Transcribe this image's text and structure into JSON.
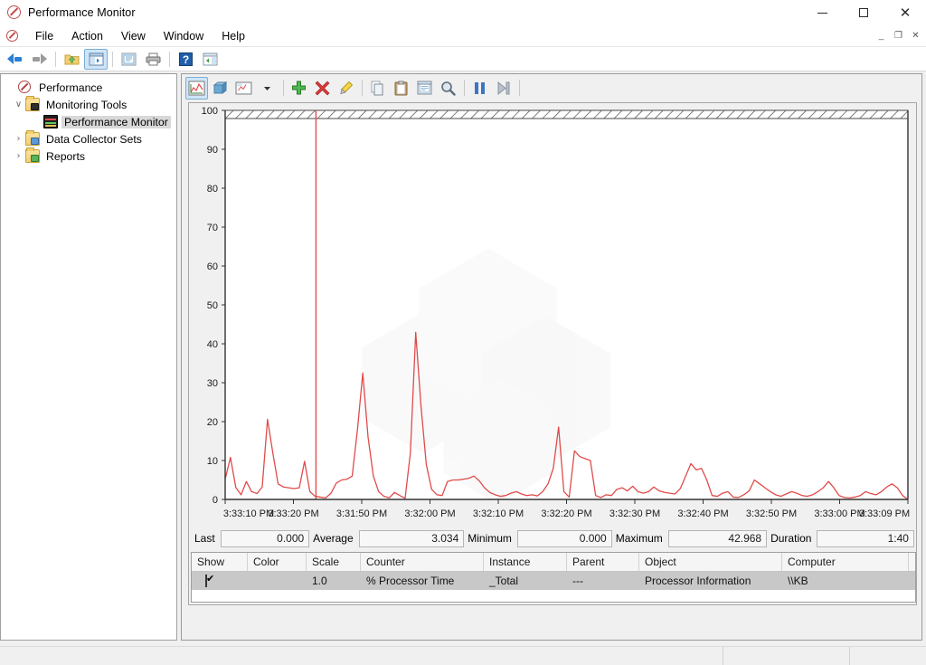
{
  "window": {
    "title": "Performance Monitor",
    "icon": "nosign-icon",
    "controls": {
      "minimize": "—",
      "maximize": "□",
      "close": "✕"
    }
  },
  "menubar": {
    "items": [
      "File",
      "Action",
      "View",
      "Window",
      "Help"
    ],
    "mdi_controls": {
      "minimize": "–",
      "restore": "❐",
      "close": "✕"
    }
  },
  "toolbar": {
    "items": [
      {
        "name": "back-arrow-icon",
        "tooltip": "Back"
      },
      {
        "name": "forward-arrow-icon",
        "tooltip": "Forward"
      },
      {
        "name": "up-folder-icon",
        "tooltip": "Up One Level"
      },
      {
        "name": "show-hide-console-tree-icon",
        "tooltip": "Show/Hide Console Tree",
        "active": true
      },
      {
        "name": "properties-icon",
        "tooltip": "Properties"
      },
      {
        "name": "print-icon",
        "tooltip": "Print"
      },
      {
        "name": "help-icon",
        "tooltip": "Help"
      },
      {
        "name": "new-window-icon",
        "tooltip": "New Window"
      }
    ]
  },
  "sidebar": {
    "tree": [
      {
        "label": "Performance",
        "level": 0,
        "twist": "",
        "icon": "nosign-icon",
        "selected": false
      },
      {
        "label": "Monitoring Tools",
        "level": 1,
        "twist": "∨",
        "icon": "folder-monitor-icon",
        "selected": false
      },
      {
        "label": "Performance Monitor",
        "level": 2,
        "twist": "",
        "icon": "perfmon-icon",
        "selected": true
      },
      {
        "label": "Data Collector Sets",
        "level": 1,
        "twist": "›",
        "icon": "folder-blue-icon",
        "selected": false
      },
      {
        "label": "Reports",
        "level": 1,
        "twist": "›",
        "icon": "folder-green-icon",
        "selected": false
      }
    ]
  },
  "graph_toolbar": {
    "items": [
      {
        "name": "view-graph-icon",
        "tooltip": "View Graph",
        "active": true
      },
      {
        "name": "view-histogram-icon",
        "tooltip": "View Histogram"
      },
      {
        "name": "view-report-icon",
        "tooltip": "View Report"
      },
      {
        "name": "chevron-down-icon",
        "tooltip": "Change graph type"
      },
      {
        "name": "add-counter-icon",
        "tooltip": "Add"
      },
      {
        "name": "delete-counter-icon",
        "tooltip": "Delete"
      },
      {
        "name": "highlight-icon",
        "tooltip": "Highlight"
      },
      {
        "name": "copy-properties-icon",
        "tooltip": "Copy Properties"
      },
      {
        "name": "paste-counter-list-icon",
        "tooltip": "Paste Counter List"
      },
      {
        "name": "properties-icon",
        "tooltip": "Properties"
      },
      {
        "name": "zoom-icon",
        "tooltip": "Zoom To"
      },
      {
        "name": "freeze-display-icon",
        "tooltip": "Freeze Display"
      },
      {
        "name": "update-data-icon",
        "tooltip": "Update Data"
      }
    ]
  },
  "stats": {
    "last_label": "Last",
    "last_value": "0.000",
    "average_label": "Average",
    "average_value": "3.034",
    "minimum_label": "Minimum",
    "minimum_value": "0.000",
    "maximum_label": "Maximum",
    "maximum_value": "42.968",
    "duration_label": "Duration",
    "duration_value": "1:40"
  },
  "legend": {
    "columns": [
      "Show",
      "Color",
      "Scale",
      "Counter",
      "Instance",
      "Parent",
      "Object",
      "Computer"
    ],
    "rows": [
      {
        "show": true,
        "color": "#e04b4b",
        "scale": "1.0",
        "counter": "% Processor Time",
        "instance": "_Total",
        "parent": "---",
        "object": "Processor Information",
        "computer": "\\\\KB"
      }
    ]
  },
  "chart_data": {
    "type": "line",
    "title": "",
    "xlabel": "",
    "ylabel": "",
    "ylim": [
      0,
      100
    ],
    "yticks": [
      0,
      10,
      20,
      30,
      40,
      50,
      60,
      70,
      80,
      90,
      100
    ],
    "xticks": [
      "3:33:10 PM",
      "3:33:20 PM",
      "3:31:50 PM",
      "3:32:00 PM",
      "3:32:10 PM",
      "3:32:20 PM",
      "3:32:30 PM",
      "3:32:40 PM",
      "3:32:50 PM",
      "3:33:00 PM",
      "3:33:09 PM"
    ],
    "grid": false,
    "line_color": "#e04b4b",
    "cursor_position_fraction": 0.133,
    "series": [
      {
        "name": "% Processor Time",
        "instance": "_Total",
        "object": "Processor Information",
        "scale": 1.0,
        "values": [
          5.2,
          10.8,
          3.1,
          1.2,
          4.6,
          2.0,
          1.5,
          3.2,
          20.6,
          12.0,
          4.0,
          3.2,
          3.0,
          2.8,
          3.0,
          9.8,
          2.0,
          0.8,
          0.6,
          0.4,
          1.6,
          4.2,
          5.0,
          5.2,
          6.0,
          18.0,
          32.5,
          16.0,
          6.0,
          2.0,
          0.8,
          0.4,
          1.8,
          1.0,
          0.3,
          12.0,
          42.968,
          24.0,
          9.0,
          2.6,
          1.2,
          1.0,
          4.6,
          5.0,
          5.0,
          5.2,
          5.4,
          6.0,
          4.8,
          3.0,
          1.8,
          1.2,
          0.8,
          1.0,
          1.6,
          2.0,
          1.4,
          1.0,
          1.2,
          0.9,
          2.0,
          4.0,
          8.0,
          18.6,
          2.0,
          0.6,
          12.5,
          11.0,
          10.5,
          10.0,
          1.0,
          0.5,
          1.2,
          1.0,
          2.6,
          3.0,
          2.2,
          3.4,
          2.0,
          1.6,
          2.0,
          3.2,
          2.2,
          1.8,
          1.6,
          1.4,
          2.8,
          6.0,
          9.2,
          7.6,
          8.0,
          5.0,
          1.0,
          0.8,
          1.6,
          2.0,
          0.6,
          0.5,
          1.2,
          2.2,
          5.0,
          4.0,
          3.0,
          2.0,
          1.2,
          0.8,
          1.4,
          2.0,
          1.6,
          1.0,
          0.8,
          1.2,
          2.0,
          3.0,
          4.6,
          3.0,
          1.0,
          0.5,
          0.4,
          0.6,
          1.0,
          2.0,
          1.5,
          1.2,
          2.0,
          3.2,
          4.0,
          3.0,
          1.0,
          0.0
        ]
      }
    ]
  }
}
